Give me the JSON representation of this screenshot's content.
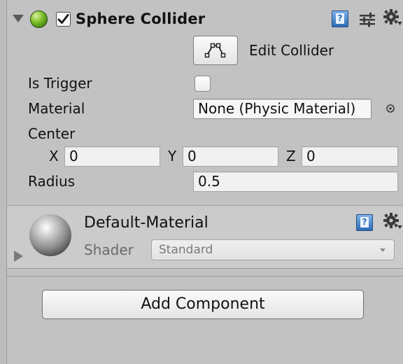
{
  "component": {
    "title": "Sphere Collider",
    "enabled": true
  },
  "edit_collider": {
    "label": "Edit Collider"
  },
  "fields": {
    "is_trigger": {
      "label": "Is Trigger",
      "checked": false
    },
    "material": {
      "label": "Material",
      "value": "None (Physic Material)"
    },
    "center": {
      "label": "Center",
      "x_label": "X",
      "x_value": "0",
      "y_label": "Y",
      "y_value": "0",
      "z_label": "Z",
      "z_value": "0"
    },
    "radius": {
      "label": "Radius",
      "value": "0.5"
    }
  },
  "material_section": {
    "name": "Default-Material",
    "shader_label": "Shader",
    "shader_value": "Standard"
  },
  "add_component": {
    "label": "Add Component"
  },
  "icons": {
    "foldout": "triangle-down-icon",
    "component": "sphere-collider-icon",
    "help": "help-book-icon",
    "presets": "presets-sliders-icon",
    "settings": "gear-icon",
    "object_picker": "target-icon"
  },
  "colors": {
    "panel_bg": "#c2c2c2",
    "accent_green": "#7fbf2a",
    "help_blue": "#2d6bb5"
  }
}
